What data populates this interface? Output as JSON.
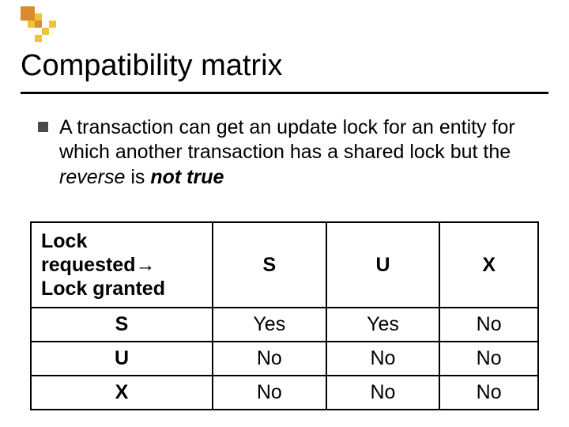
{
  "title": "Compatibility matrix",
  "bullet": {
    "part1": "A transaction can get an update lock for an entity for which another transaction has a shared lock but the ",
    "reverse": "reverse",
    "part2": " is ",
    "nottrue": "not true"
  },
  "table": {
    "header": {
      "line1": "Lock",
      "line2_a": "requested",
      "line2_arrow": "→",
      "line3": "Lock granted"
    },
    "cols": [
      "S",
      "U",
      "X"
    ],
    "rows": [
      {
        "label": "S",
        "cells": [
          "Yes",
          "Yes",
          "No"
        ]
      },
      {
        "label": "U",
        "cells": [
          "No",
          "No",
          "No"
        ]
      },
      {
        "label": "X",
        "cells": [
          "No",
          "No",
          "No"
        ]
      }
    ]
  },
  "chart_data": {
    "type": "table",
    "title": "Compatibility matrix",
    "row_axis": "Lock granted",
    "col_axis": "Lock requested",
    "columns": [
      "S",
      "U",
      "X"
    ],
    "rows": [
      "S",
      "U",
      "X"
    ],
    "cells": [
      [
        "Yes",
        "Yes",
        "No"
      ],
      [
        "No",
        "No",
        "No"
      ],
      [
        "No",
        "No",
        "No"
      ]
    ]
  }
}
